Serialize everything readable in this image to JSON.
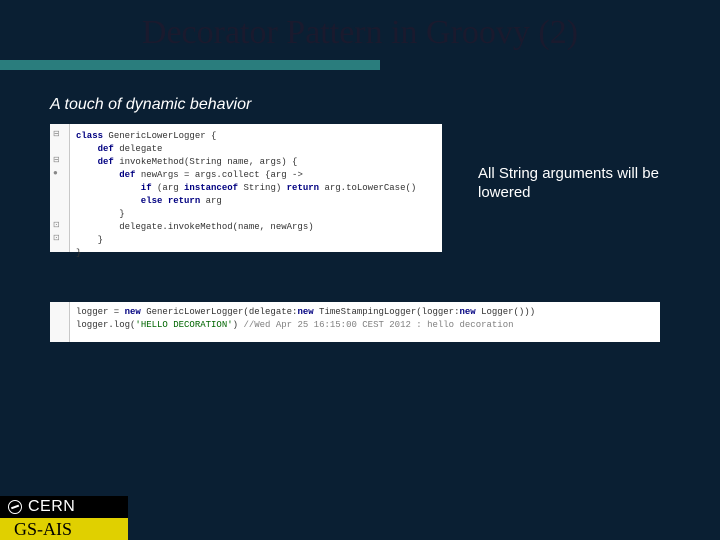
{
  "title": "Decorator Pattern in Groovy (2)",
  "subtitle": "A touch of dynamic behavior",
  "annotation": "All String arguments will be lowered",
  "code1": {
    "l1a": "class",
    "l1b": " GenericLowerLogger {",
    "l2a": "    def",
    "l2b": " delegate",
    "l3a": "    def",
    "l3b": " invokeMethod(String name, args) {",
    "l4a": "        def",
    "l4b": " newArgs = args.collect {arg ->",
    "l5a": "            if",
    "l5b": " (arg ",
    "l5c": "instanceof",
    "l5d": " String) ",
    "l5e": "return",
    "l5f": " arg.toLowerCase()",
    "l6a": "            else return",
    "l6b": " arg",
    "l7": "        }",
    "l8": "        delegate.invokeMethod(name, newArgs)",
    "l9": "    }",
    "l10": "}"
  },
  "code2": {
    "l1a": "logger = ",
    "l1b": "new",
    "l1c": " GenericLowerLogger(delegate:",
    "l1d": "new",
    "l1e": " TimeStampingLogger(logger:",
    "l1f": "new",
    "l1g": " Logger()))",
    "l2a": "logger.log(",
    "l2b": "'HELLO DECORATION'",
    "l2c": ") ",
    "l2d": "//Wed Apr 25 16:15:00 CEST 2012 : hello decoration"
  },
  "footer": {
    "org": "CERN",
    "dept": "GS-AIS"
  }
}
